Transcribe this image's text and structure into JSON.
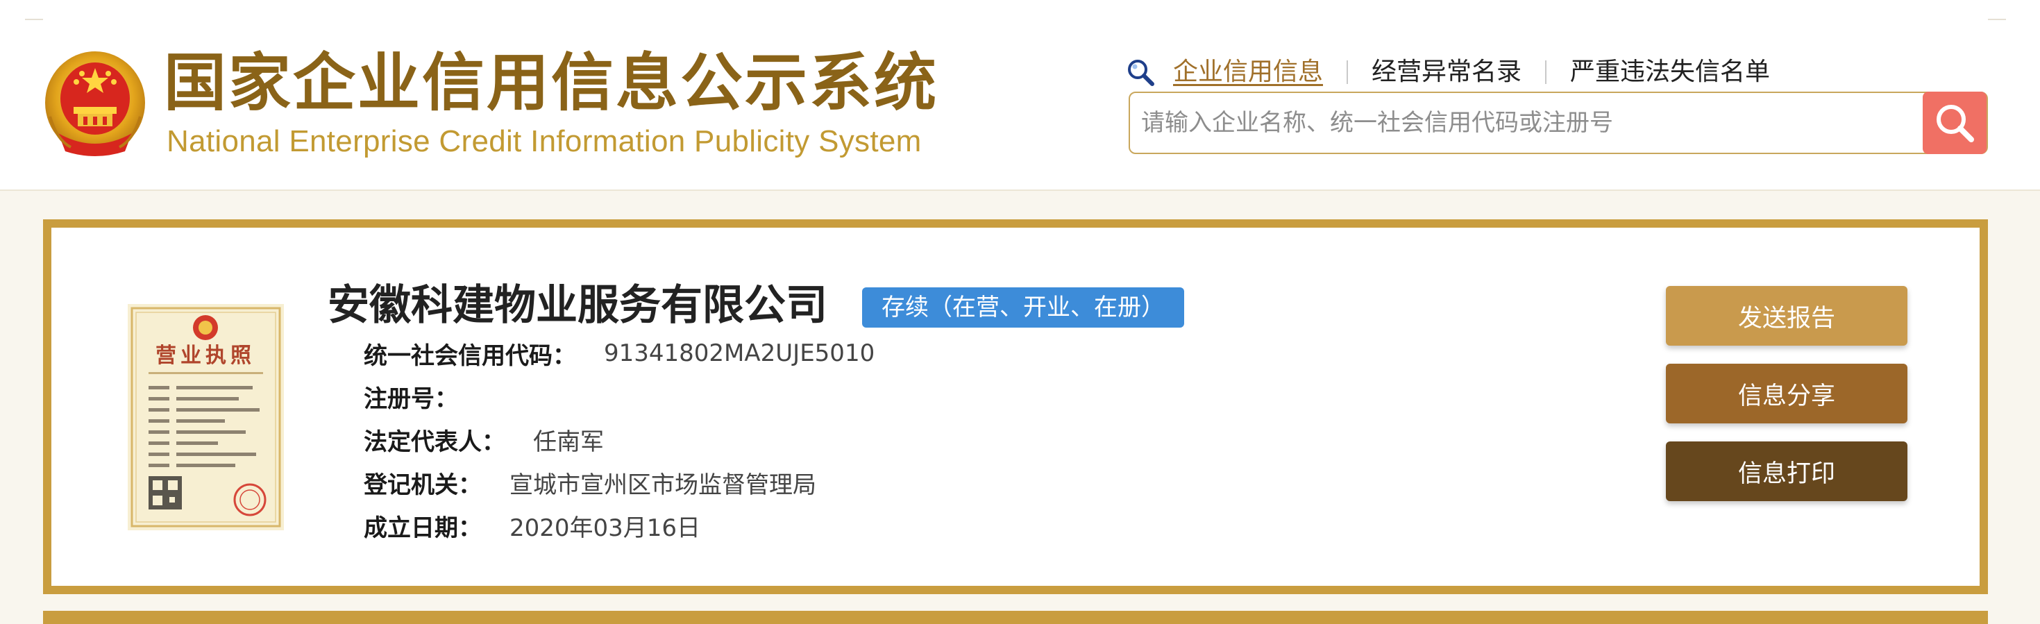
{
  "header": {
    "title_cn": "国家企业信用信息公示系统",
    "title_en": "National Enterprise Credit Information Publicity System",
    "nav": [
      {
        "label": "企业信用信息",
        "active": true
      },
      {
        "label": "经营异常名录",
        "active": false
      },
      {
        "label": "严重违法失信名单",
        "active": false
      }
    ],
    "search": {
      "value": "",
      "placeholder": "请输入企业名称、统一社会信用代码或注册号"
    },
    "icons": {
      "nav": "search-icon",
      "search_button": "search-icon",
      "emblem": "national-emblem"
    }
  },
  "company": {
    "name": "安徽科建物业服务有限公司",
    "status": "存续（在营、开业、在册）",
    "fields": [
      {
        "label": "统一社会信用代码：",
        "value": "91341802MA2UJE5010"
      },
      {
        "label": "注册号：",
        "value": ""
      },
      {
        "label": "法定代表人：",
        "value": "任南军"
      },
      {
        "label": "登记机关：",
        "value": "宣城市宣州区市场监督管理局"
      },
      {
        "label": "成立日期：",
        "value": "2020年03月16日"
      }
    ],
    "license_title": "营业执照",
    "actions": [
      {
        "label": "发送报告"
      },
      {
        "label": "信息分享"
      },
      {
        "label": "信息打印"
      }
    ]
  },
  "colors": {
    "brand_gold": "#c99d3f",
    "title_brown": "#8a6318",
    "status_blue": "#3d8cd9",
    "search_red": "#f07064",
    "btn_send": "#c99a4d",
    "btn_share": "#9c6729",
    "btn_print": "#66471d"
  }
}
